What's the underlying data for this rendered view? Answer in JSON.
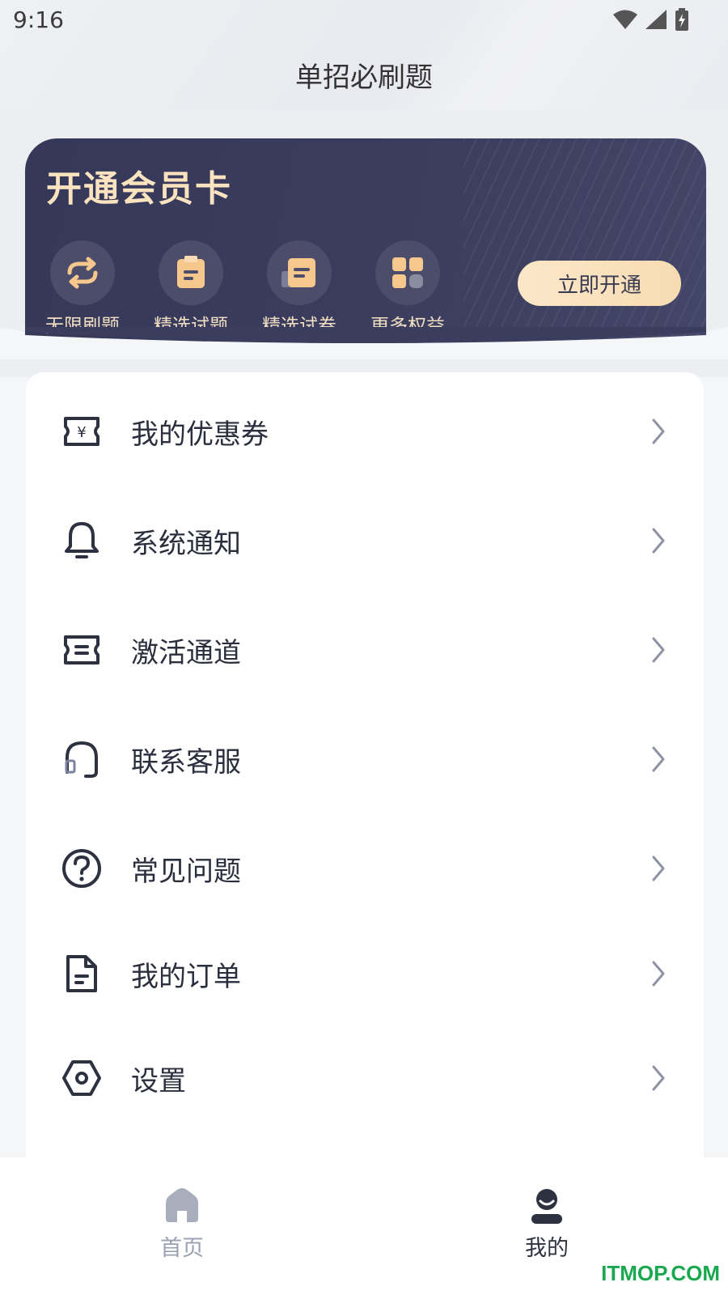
{
  "status_bar": {
    "time": "9:16"
  },
  "header": {
    "title": "单招必刷题"
  },
  "member_card": {
    "title": "开通会员卡",
    "benefits": [
      {
        "label": "无限刷题",
        "icon": "refresh-icon"
      },
      {
        "label": "精选试题",
        "icon": "clipboard-icon"
      },
      {
        "label": "精选试卷",
        "icon": "paper-icon"
      },
      {
        "label": "更多权益",
        "icon": "grid-icon"
      }
    ],
    "open_button": "立即开通"
  },
  "menu": {
    "items": [
      {
        "label": "我的优惠券",
        "icon": "coupon-icon"
      },
      {
        "label": "系统通知",
        "icon": "bell-icon"
      },
      {
        "label": "激活通道",
        "icon": "ticket-icon"
      },
      {
        "label": "联系客服",
        "icon": "headset-icon"
      },
      {
        "label": "常见问题",
        "icon": "question-icon"
      },
      {
        "label": "我的订单",
        "icon": "document-icon"
      },
      {
        "label": "设置",
        "icon": "settings-icon"
      }
    ]
  },
  "bottom_nav": {
    "tabs": [
      {
        "label": "首页",
        "icon": "home-icon",
        "active": false
      },
      {
        "label": "我的",
        "icon": "profile-icon",
        "active": true
      }
    ]
  },
  "watermark": "ITMOP.COM",
  "colors": {
    "card_bg": "#3b3d5e",
    "gold": "#fbe3bf",
    "active_tab": "#2d3140",
    "inactive_tab": "#9aa0b2",
    "watermark": "#1aa84f"
  }
}
